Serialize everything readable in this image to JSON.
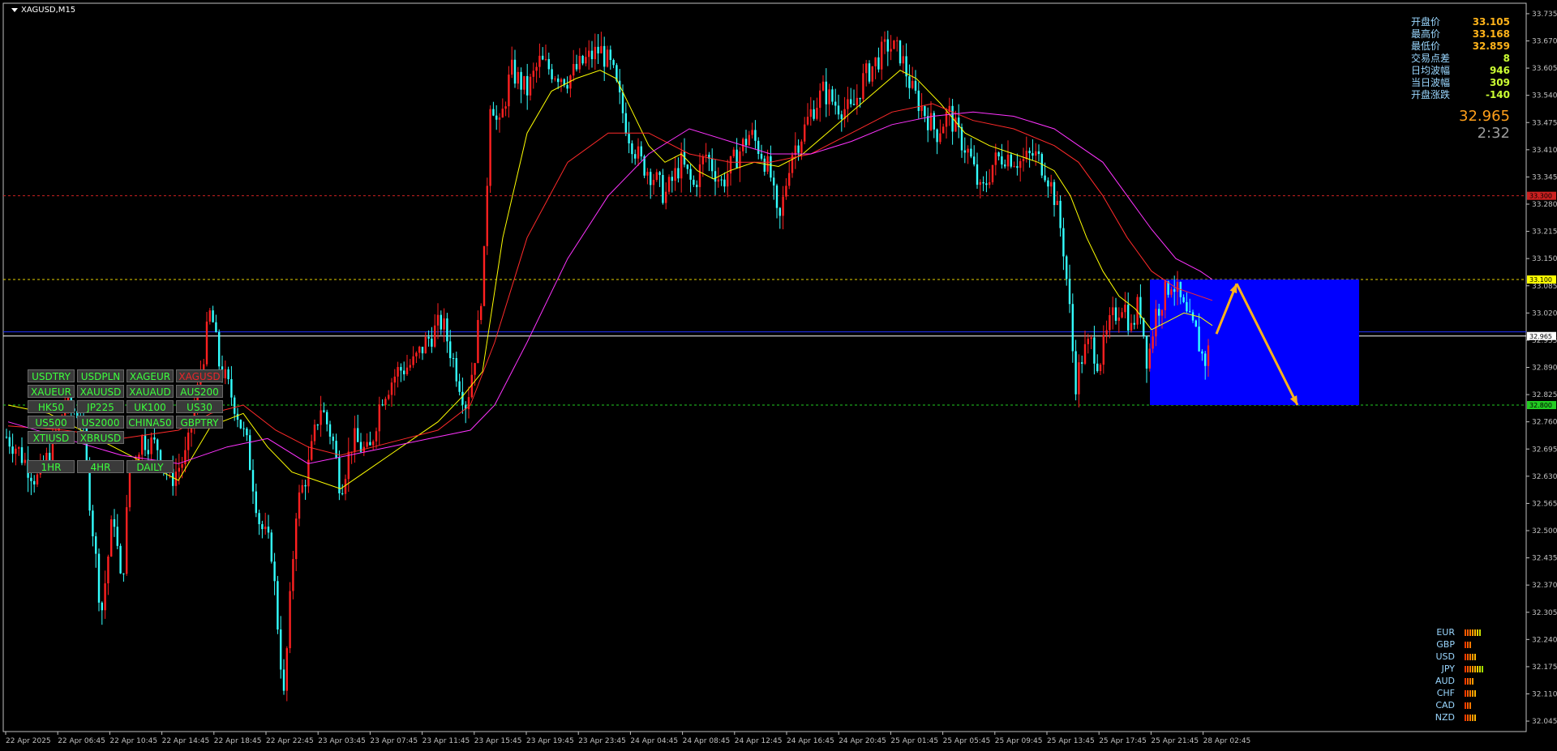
{
  "chart_title": "XAGUSD,M15",
  "chart_data": {
    "type": "candlestick",
    "symbol": "XAGUSD",
    "timeframe": "M15",
    "ylim": [
      32.02,
      33.76
    ],
    "y_ticks": [
      "33.735",
      "33.670",
      "33.605",
      "33.540",
      "33.475",
      "33.410",
      "33.345",
      "33.280",
      "33.215",
      "33.150",
      "33.085",
      "33.020",
      "32.955",
      "32.890",
      "32.825",
      "32.760",
      "32.695",
      "32.630",
      "32.565",
      "32.500",
      "32.435",
      "32.370",
      "32.305",
      "32.240",
      "32.175",
      "32.110",
      "32.045"
    ],
    "x_ticks": [
      "22 Apr 2025",
      "22 Apr 06:45",
      "22 Apr 10:45",
      "22 Apr 14:45",
      "22 Apr 18:45",
      "22 Apr 22:45",
      "23 Apr 03:45",
      "23 Apr 07:45",
      "23 Apr 11:45",
      "23 Apr 15:45",
      "23 Apr 19:45",
      "23 Apr 23:45",
      "24 Apr 04:45",
      "24 Apr 08:45",
      "24 Apr 12:45",
      "24 Apr 16:45",
      "24 Apr 20:45",
      "25 Apr 01:45",
      "25 Apr 05:45",
      "25 Apr 09:45",
      "25 Apr 13:45",
      "25 Apr 17:45",
      "25 Apr 21:45",
      "28 Apr 02:45"
    ],
    "price_path": [
      [
        0,
        32.74
      ],
      [
        20,
        32.7
      ],
      [
        45,
        32.62
      ],
      [
        60,
        32.68
      ],
      [
        80,
        32.8
      ],
      [
        100,
        32.78
      ],
      [
        125,
        32.3
      ],
      [
        140,
        32.55
      ],
      [
        150,
        32.35
      ],
      [
        160,
        32.65
      ],
      [
        175,
        32.72
      ],
      [
        195,
        32.7
      ],
      [
        210,
        32.62
      ],
      [
        230,
        32.68
      ],
      [
        245,
        32.85
      ],
      [
        260,
        33.03
      ],
      [
        270,
        32.9
      ],
      [
        290,
        32.8
      ],
      [
        305,
        32.7
      ],
      [
        320,
        32.52
      ],
      [
        335,
        32.45
      ],
      [
        350,
        32.1
      ],
      [
        365,
        32.55
      ],
      [
        380,
        32.65
      ],
      [
        395,
        32.8
      ],
      [
        410,
        32.72
      ],
      [
        420,
        32.6
      ],
      [
        435,
        32.72
      ],
      [
        455,
        32.68
      ],
      [
        470,
        32.82
      ],
      [
        490,
        32.88
      ],
      [
        510,
        32.9
      ],
      [
        525,
        32.95
      ],
      [
        545,
        33.0
      ],
      [
        560,
        32.9
      ],
      [
        575,
        32.8
      ],
      [
        588,
        32.95
      ],
      [
        597,
        33.15
      ],
      [
        605,
        33.55
      ],
      [
        615,
        33.45
      ],
      [
        630,
        33.6
      ],
      [
        650,
        33.55
      ],
      [
        665,
        33.62
      ],
      [
        680,
        33.6
      ],
      [
        700,
        33.58
      ],
      [
        720,
        33.62
      ],
      [
        740,
        33.65
      ],
      [
        755,
        33.6
      ],
      [
        765,
        33.52
      ],
      [
        775,
        33.45
      ],
      [
        790,
        33.38
      ],
      [
        805,
        33.35
      ],
      [
        820,
        33.3
      ],
      [
        840,
        33.38
      ],
      [
        855,
        33.32
      ],
      [
        870,
        33.4
      ],
      [
        890,
        33.33
      ],
      [
        910,
        33.4
      ],
      [
        925,
        33.45
      ],
      [
        940,
        33.4
      ],
      [
        950,
        33.35
      ],
      [
        960,
        33.22
      ],
      [
        975,
        33.4
      ],
      [
        990,
        33.45
      ],
      [
        1000,
        33.5
      ],
      [
        1015,
        33.55
      ],
      [
        1030,
        33.52
      ],
      [
        1050,
        33.5
      ],
      [
        1065,
        33.58
      ],
      [
        1080,
        33.62
      ],
      [
        1095,
        33.66
      ],
      [
        1110,
        33.64
      ],
      [
        1125,
        33.55
      ],
      [
        1140,
        33.5
      ],
      [
        1155,
        33.45
      ],
      [
        1170,
        33.5
      ],
      [
        1180,
        33.45
      ],
      [
        1195,
        33.4
      ],
      [
        1210,
        33.3
      ],
      [
        1225,
        33.38
      ],
      [
        1240,
        33.4
      ],
      [
        1260,
        33.38
      ],
      [
        1275,
        33.4
      ],
      [
        1290,
        33.36
      ],
      [
        1300,
        33.3
      ],
      [
        1310,
        33.2
      ],
      [
        1318,
        33.05
      ],
      [
        1326,
        32.85
      ],
      [
        1335,
        32.92
      ],
      [
        1345,
        32.95
      ],
      [
        1355,
        32.9
      ],
      [
        1370,
        33.0
      ],
      [
        1385,
        33.05
      ],
      [
        1395,
        32.98
      ],
      [
        1405,
        33.05
      ],
      [
        1415,
        32.9
      ],
      [
        1425,
        33.02
      ],
      [
        1435,
        33.06
      ],
      [
        1445,
        33.1
      ],
      [
        1455,
        33.05
      ],
      [
        1465,
        33.0
      ],
      [
        1475,
        32.97
      ],
      [
        1485,
        32.9
      ],
      [
        1495,
        32.96
      ]
    ],
    "moving_averages": [
      {
        "color": "#ffff00",
        "points": [
          [
            10,
            32.8
          ],
          [
            60,
            32.78
          ],
          [
            120,
            32.72
          ],
          [
            180,
            32.66
          ],
          [
            220,
            32.62
          ],
          [
            260,
            32.75
          ],
          [
            300,
            32.78
          ],
          [
            330,
            32.7
          ],
          [
            360,
            32.64
          ],
          [
            390,
            32.62
          ],
          [
            420,
            32.6
          ],
          [
            450,
            32.64
          ],
          [
            480,
            32.68
          ],
          [
            510,
            32.72
          ],
          [
            540,
            32.76
          ],
          [
            570,
            32.82
          ],
          [
            595,
            32.88
          ],
          [
            620,
            33.2
          ],
          [
            650,
            33.45
          ],
          [
            680,
            33.55
          ],
          [
            710,
            33.58
          ],
          [
            740,
            33.6
          ],
          [
            760,
            33.58
          ],
          [
            780,
            33.5
          ],
          [
            800,
            33.42
          ],
          [
            820,
            33.38
          ],
          [
            840,
            33.4
          ],
          [
            860,
            33.36
          ],
          [
            880,
            33.34
          ],
          [
            900,
            33.36
          ],
          [
            930,
            33.38
          ],
          [
            960,
            33.37
          ],
          [
            990,
            33.4
          ],
          [
            1020,
            33.45
          ],
          [
            1050,
            33.5
          ],
          [
            1080,
            33.55
          ],
          [
            1110,
            33.6
          ],
          [
            1130,
            33.58
          ],
          [
            1160,
            33.52
          ],
          [
            1190,
            33.45
          ],
          [
            1220,
            33.42
          ],
          [
            1250,
            33.4
          ],
          [
            1280,
            33.38
          ],
          [
            1300,
            33.36
          ],
          [
            1320,
            33.3
          ],
          [
            1340,
            33.2
          ],
          [
            1360,
            33.12
          ],
          [
            1380,
            33.06
          ],
          [
            1400,
            33.03
          ],
          [
            1420,
            32.98
          ],
          [
            1440,
            33.0
          ],
          [
            1460,
            33.02
          ],
          [
            1480,
            33.01
          ],
          [
            1495,
            32.99
          ]
        ]
      },
      {
        "color": "#ff2a2a",
        "points": [
          [
            10,
            32.75
          ],
          [
            80,
            32.74
          ],
          [
            150,
            32.72
          ],
          [
            220,
            32.74
          ],
          [
            260,
            32.78
          ],
          [
            300,
            32.8
          ],
          [
            340,
            32.74
          ],
          [
            380,
            32.7
          ],
          [
            420,
            32.68
          ],
          [
            460,
            32.7
          ],
          [
            500,
            32.72
          ],
          [
            540,
            32.74
          ],
          [
            580,
            32.8
          ],
          [
            610,
            32.95
          ],
          [
            650,
            33.2
          ],
          [
            700,
            33.38
          ],
          [
            750,
            33.45
          ],
          [
            800,
            33.45
          ],
          [
            850,
            33.4
          ],
          [
            900,
            33.38
          ],
          [
            950,
            33.38
          ],
          [
            1000,
            33.4
          ],
          [
            1050,
            33.45
          ],
          [
            1100,
            33.5
          ],
          [
            1150,
            33.52
          ],
          [
            1200,
            33.48
          ],
          [
            1250,
            33.46
          ],
          [
            1300,
            33.42
          ],
          [
            1330,
            33.38
          ],
          [
            1360,
            33.3
          ],
          [
            1390,
            33.2
          ],
          [
            1420,
            33.12
          ],
          [
            1450,
            33.08
          ],
          [
            1480,
            33.06
          ],
          [
            1495,
            33.05
          ]
        ]
      },
      {
        "color": "#ff33ff",
        "points": [
          [
            10,
            32.76
          ],
          [
            80,
            32.72
          ],
          [
            150,
            32.68
          ],
          [
            220,
            32.66
          ],
          [
            280,
            32.7
          ],
          [
            330,
            32.72
          ],
          [
            380,
            32.66
          ],
          [
            430,
            32.68
          ],
          [
            480,
            32.7
          ],
          [
            530,
            32.72
          ],
          [
            580,
            32.74
          ],
          [
            610,
            32.8
          ],
          [
            650,
            32.95
          ],
          [
            700,
            33.15
          ],
          [
            750,
            33.3
          ],
          [
            800,
            33.4
          ],
          [
            850,
            33.46
          ],
          [
            900,
            33.43
          ],
          [
            950,
            33.4
          ],
          [
            1000,
            33.4
          ],
          [
            1050,
            33.43
          ],
          [
            1100,
            33.47
          ],
          [
            1150,
            33.49
          ],
          [
            1200,
            33.5
          ],
          [
            1250,
            33.49
          ],
          [
            1300,
            33.46
          ],
          [
            1330,
            33.42
          ],
          [
            1360,
            33.38
          ],
          [
            1390,
            33.3
          ],
          [
            1420,
            33.22
          ],
          [
            1450,
            33.15
          ],
          [
            1480,
            33.12
          ],
          [
            1495,
            33.1
          ]
        ]
      }
    ],
    "horizontal_lines": [
      {
        "value": 33.3,
        "color": "#cc2020",
        "label": "33.300",
        "label_bg": "#cc2020",
        "style": "dashed"
      },
      {
        "value": 33.1,
        "color": "#e6d200",
        "label": "33.100",
        "label_bg": "#ffff00",
        "style": "dashed"
      },
      {
        "value": 32.965,
        "color": "#ffffff",
        "label": "32.965",
        "label_bg": "#ffffff",
        "style": "solid"
      },
      {
        "value": 32.975,
        "color": "#2233ff",
        "label": "",
        "label_bg": "",
        "style": "solid"
      },
      {
        "value": 32.8,
        "color": "#22cc22",
        "label": "32.800",
        "label_bg": "#22cc22",
        "style": "dashed"
      }
    ],
    "rectangle": {
      "x1": 1418,
      "x2": 1676,
      "y1": 33.1,
      "y2": 32.8,
      "color": "#0000ff"
    },
    "arrows": [
      {
        "from": [
          1500,
          32.97
        ],
        "to": [
          1525,
          33.09
        ],
        "color": "#ffb31a"
      },
      {
        "from": [
          1525,
          33.09
        ],
        "to": [
          1600,
          32.8
        ],
        "color": "#ffb31a"
      }
    ]
  },
  "quote_panel": {
    "rows": [
      {
        "label": "开盘价",
        "value": "33.105",
        "color": "#ffb31a"
      },
      {
        "label": "最高价",
        "value": "33.168",
        "color": "#ffb31a"
      },
      {
        "label": "最低价",
        "value": "32.859",
        "color": "#ffb31a"
      },
      {
        "label": "交易点差",
        "value": "8",
        "color": "#ccff33"
      },
      {
        "label": "日均波幅",
        "value": "946",
        "color": "#ccff33"
      },
      {
        "label": "当日波幅",
        "value": "309",
        "color": "#ccff33"
      },
      {
        "label": "开盘涨跌",
        "value": "-140",
        "color": "#ccff33"
      }
    ],
    "current_price": "32.965",
    "countdown": "2:32"
  },
  "symbol_buttons": [
    [
      "USDTRY",
      "USDPLN",
      "XAGEUR",
      "XAGUSD"
    ],
    [
      "XAUEUR",
      "XAUUSD",
      "XAUAUD",
      "AUS200"
    ],
    [
      "HK50",
      "JP225",
      "UK100",
      "US30"
    ],
    [
      "US500",
      "US2000",
      "CHINA50",
      "GBPTRY"
    ],
    [
      "XTIUSD",
      "XBRUSD"
    ]
  ],
  "active_symbol": "XAGUSD",
  "timeframe_buttons": [
    "1HR",
    "4HR",
    "DAILY"
  ],
  "currency_strength": [
    {
      "name": "EUR",
      "bars": [
        "#ff5a00",
        "#ff5a00",
        "#ff7a00",
        "#ff9a00",
        "#ffb400",
        "#ffce00",
        "#c8e000"
      ]
    },
    {
      "name": "GBP",
      "bars": [
        "#ff3a00",
        "#ff5a00",
        "#ff7a00"
      ]
    },
    {
      "name": "USD",
      "bars": [
        "#ff3a00",
        "#ff5a00",
        "#ff7a00",
        "#ff9a00",
        "#ffb400"
      ]
    },
    {
      "name": "JPY",
      "bars": [
        "#ff3a00",
        "#ff5a00",
        "#ff7a00",
        "#ff9a00",
        "#ffb400",
        "#ffce00",
        "#d8e000",
        "#a0e000"
      ]
    },
    {
      "name": "AUD",
      "bars": [
        "#ff3a00",
        "#ff5a00",
        "#ff7a00",
        "#ff9a00"
      ]
    },
    {
      "name": "CHF",
      "bars": [
        "#ff3a00",
        "#ff5a00",
        "#ff7a00",
        "#ff9a00",
        "#ffb400"
      ]
    },
    {
      "name": "CAD",
      "bars": [
        "#ff3a00",
        "#ff5a00",
        "#ff7a00"
      ]
    },
    {
      "name": "NZD",
      "bars": [
        "#ff3a00",
        "#ff5a00",
        "#ff7a00",
        "#ff9a00",
        "#ffb400"
      ]
    }
  ],
  "colors": {
    "bull": "#ff2020",
    "bear": "#33ffff",
    "axis": "#c0c0c0",
    "background": "#000000"
  }
}
